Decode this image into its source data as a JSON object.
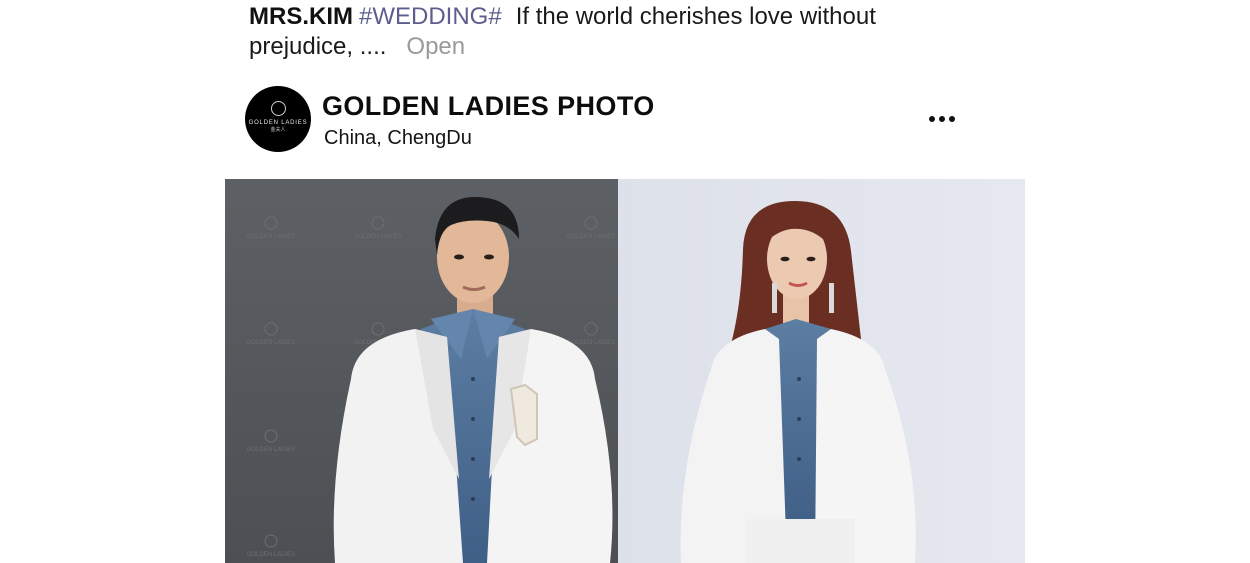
{
  "post": {
    "author": "MRS.KIM",
    "hashtag": "#WEDDING#",
    "text": "If the world cherishes love without prejudice, ....",
    "open_label": "Open"
  },
  "profile": {
    "avatar_brand": "GOLDEN LADIES",
    "avatar_brand_cn": "金夫人",
    "name": "GOLDEN LADIES PHOTO",
    "location": "China,  ChengDu",
    "more_icon": "more-horizontal-icon"
  },
  "photo": {
    "watermark_brand": "GOLDEN LADIES",
    "watermark_cn": "成都金夫人",
    "colors": {
      "left_bg": "#55585c",
      "right_bg": "#e3e6ee",
      "blazer": "#f3f3f3",
      "denim": "#4e6f94",
      "skin": "#e8c3a8",
      "hair_man": "#1c1c1e",
      "hair_woman": "#6a2e22"
    }
  }
}
